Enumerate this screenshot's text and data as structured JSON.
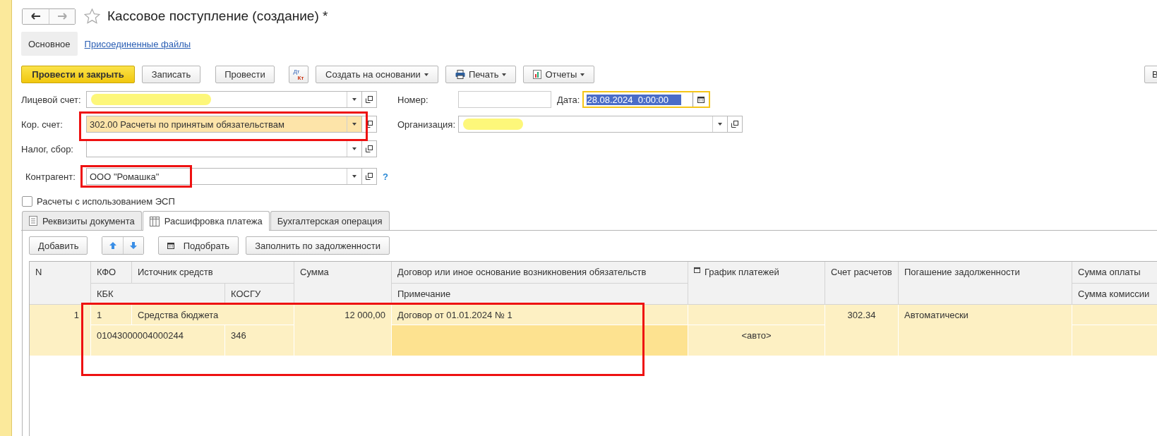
{
  "window": {
    "title": "Кассовое поступление (создание) *"
  },
  "form_tabs": [
    {
      "label": "Основное",
      "selected": true
    },
    {
      "label": "Присоединенные файлы",
      "selected": false
    }
  ],
  "toolbar": [
    {
      "kind": "primary",
      "label": "Провести и закрыть"
    },
    {
      "kind": "plain",
      "label": "Записать"
    },
    {
      "kind": "plain",
      "label": "Провести"
    },
    {
      "kind": "dtkt",
      "label": "Дт",
      "label2": "Кт"
    },
    {
      "kind": "menu",
      "label": "Создать на основании"
    },
    {
      "kind": "print",
      "label": "Печать"
    },
    {
      "kind": "report",
      "label": "Отчеты"
    }
  ],
  "toolbar_right": {
    "label": "В"
  },
  "left_fields": [
    {
      "label": "Лицевой счет:",
      "redacted": true,
      "highlighted": false
    },
    {
      "label": "Кор. счет:",
      "value": "302.00 Расчеты по принятым обязательствам",
      "redacted": false,
      "highlighted": true
    },
    {
      "label": "Налог, сбор:",
      "redacted": false,
      "highlighted": false
    },
    {
      "label": "Контрагент:",
      "value": "ООО \"Ромашка\"",
      "redacted": false,
      "highlighted": false,
      "help": "?"
    }
  ],
  "number": {
    "label": "Номер:"
  },
  "date": {
    "label": "Дата:",
    "value": "28.08.2024  0:00:00",
    "focused": true
  },
  "organization": {
    "label": "Организация:",
    "redacted": true
  },
  "esp_checkbox": {
    "label": "Расчеты с использованием ЭСП",
    "checked": false
  },
  "tabs": [
    {
      "label": "Реквизиты документа",
      "selected": false
    },
    {
      "label": "Расшифровка платежа",
      "selected": true
    },
    {
      "label": "Бухгалтерская операция",
      "selected": false
    }
  ],
  "table_toolbar": [
    {
      "kind": "plain",
      "label": "Добавить"
    },
    {
      "kind": "arrows"
    },
    {
      "kind": "calendar",
      "label": "Подобрать"
    },
    {
      "kind": "plain",
      "label": "Заполнить по задолженности"
    }
  ],
  "table": {
    "header": [
      "N",
      "КФО",
      "Источник средств",
      "Сумма",
      "Договор или иное основание возникновения обязательств",
      "График платежей",
      "Счет расчетов",
      "Погашение задолженности",
      "Сумма оплаты",
      "КБК",
      "КОСГУ",
      "Примечание",
      "Сумма комиссии"
    ],
    "rows": [
      {
        "n": "1",
        "kfo": "1",
        "source": "Средства бюджета",
        "sum": "12 000,00",
        "contract": "Договор от 01.01.2024 № 1",
        "kbk": "01043000004000244",
        "kosgu": "346",
        "schedule": "<авто>",
        "account": "302.34",
        "repayment": "Автоматически",
        "selected": true,
        "note_focused": true
      }
    ]
  }
}
